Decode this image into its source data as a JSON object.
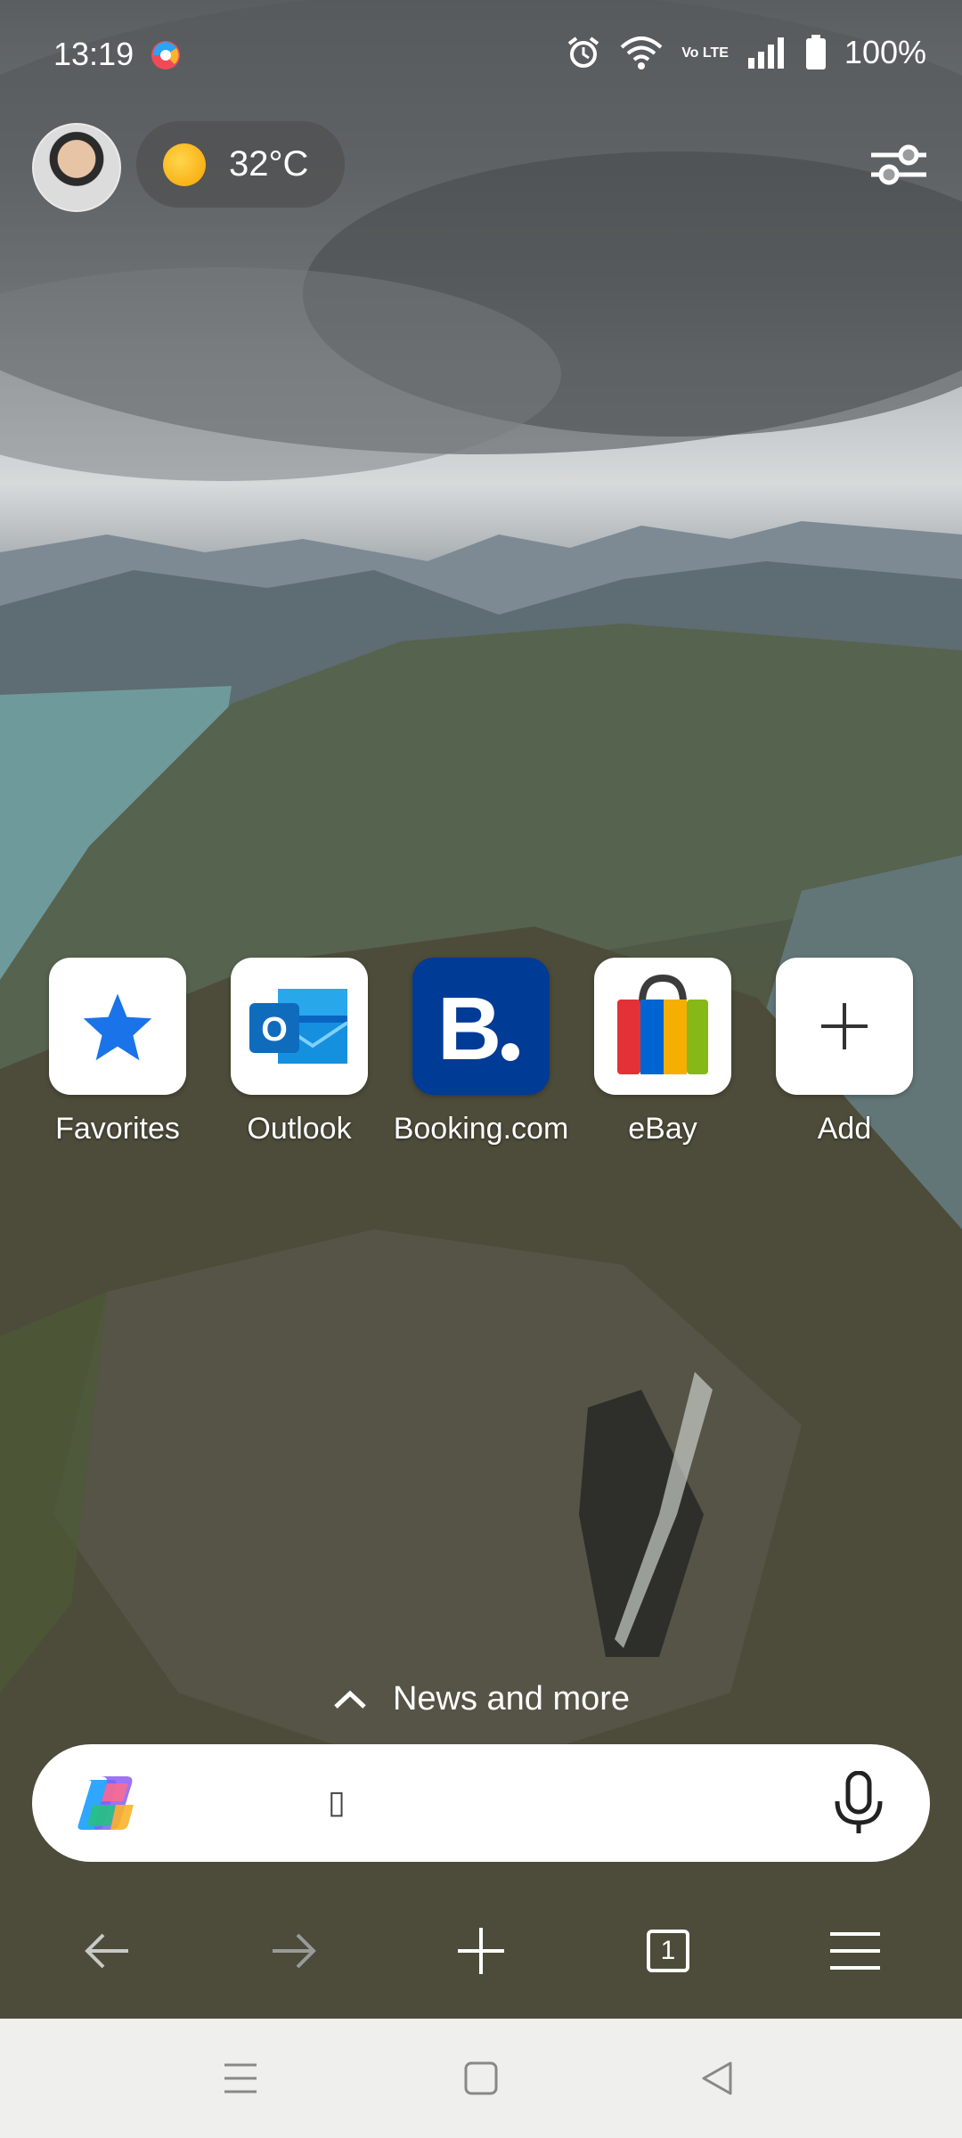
{
  "status": {
    "time": "13:19",
    "battery": "100%",
    "network": "Vo LTE"
  },
  "weather": {
    "temp": "32°C"
  },
  "tiles": [
    {
      "label": "Favorites",
      "icon": "star-icon"
    },
    {
      "label": "Outlook",
      "icon": "outlook-icon"
    },
    {
      "label": "Booking.com",
      "icon": "booking-icon"
    },
    {
      "label": "eBay",
      "icon": "ebay-icon"
    },
    {
      "label": "Add",
      "icon": "plus-icon"
    }
  ],
  "news": {
    "label": "News and more"
  },
  "search": {
    "cursor": "▯"
  },
  "toolbar": {
    "tab_count": "1"
  },
  "colors": {
    "accent": "#1a73e8",
    "booking": "#003b95"
  }
}
